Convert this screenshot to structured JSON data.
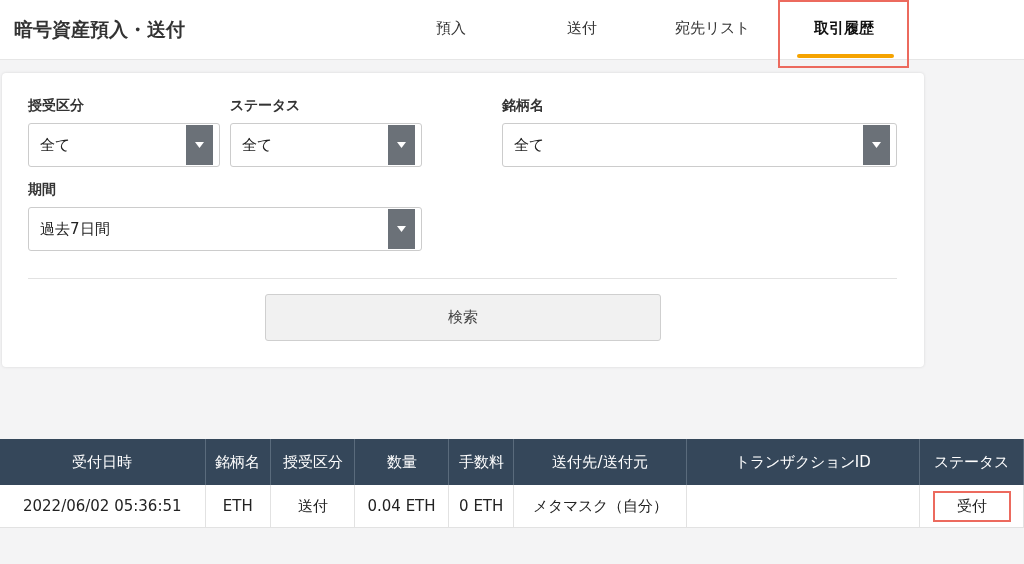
{
  "header": {
    "title": "暗号資産預入・送付"
  },
  "tabs": [
    {
      "label": "預入",
      "selected": false,
      "highlighted": false
    },
    {
      "label": "送付",
      "selected": false,
      "highlighted": false
    },
    {
      "label": "宛先リスト",
      "selected": false,
      "highlighted": false
    },
    {
      "label": "取引履歴",
      "selected": true,
      "highlighted": true
    }
  ],
  "filters": [
    {
      "label": "授受区分",
      "value": "全て"
    },
    {
      "label": "ステータス",
      "value": "全て"
    },
    {
      "label": "銘柄名",
      "value": "全て"
    },
    {
      "label": "期間",
      "value": "過去7日間"
    }
  ],
  "search_button": "検索",
  "table": {
    "columns": [
      "受付日時",
      "銘柄名",
      "授受区分",
      "数量",
      "手数料",
      "送付先/送付元",
      "トランザクションID",
      "ステータス"
    ],
    "rows": [
      {
        "cells": [
          "2022/06/02 05:36:51",
          "ETH",
          "送付",
          "0.04 ETH",
          "0 ETH",
          "メタマスク（自分）",
          "",
          "受付"
        ],
        "status_highlighted": true
      }
    ]
  }
}
